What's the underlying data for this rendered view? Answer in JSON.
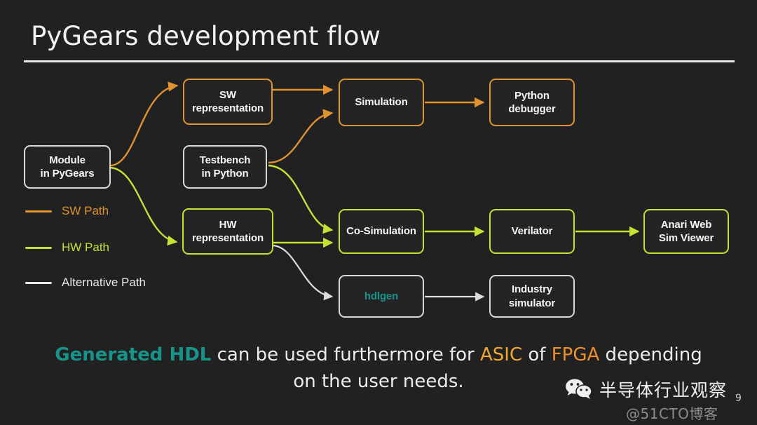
{
  "slide": {
    "title": "PyGears development flow",
    "page_number": "9",
    "background_color": "#212121"
  },
  "colors": {
    "sw_path": "#e0922f",
    "hw_path": "#c8e033",
    "alt_path": "#d8d8d8",
    "teal": "#17948a",
    "gold": "#f0a62f",
    "orange": "#ef8f2b",
    "text": "#f5f5f5"
  },
  "nodes": [
    {
      "id": "module",
      "label": "Module\nin PyGears",
      "style": "alt"
    },
    {
      "id": "sw-rep",
      "label": "SW\nrepresentation",
      "style": "sw"
    },
    {
      "id": "testbench",
      "label": "Testbench\nin Python",
      "style": "alt"
    },
    {
      "id": "hw-rep",
      "label": "HW\nrepresentation",
      "style": "hw"
    },
    {
      "id": "simulation",
      "label": "Simulation",
      "style": "sw"
    },
    {
      "id": "python-debugger",
      "label": "Python\ndebugger",
      "style": "sw"
    },
    {
      "id": "co-simulation",
      "label": "Co-Simulation",
      "style": "hw"
    },
    {
      "id": "verilator",
      "label": "Verilator",
      "style": "hw"
    },
    {
      "id": "anari",
      "label": "Anari Web\nSim Viewer",
      "style": "hw"
    },
    {
      "id": "hdlgen",
      "label": "hdlgen",
      "style": "alt"
    },
    {
      "id": "industry-simulator",
      "label": "Industry\nsimulator",
      "style": "alt"
    }
  ],
  "legend": [
    {
      "label": "SW Path",
      "color": "#e0922f"
    },
    {
      "label": "HW Path",
      "color": "#c8e033"
    },
    {
      "label": "Alternative Path",
      "color": "#e8e8e8"
    }
  ],
  "caption": {
    "part1": "Generated HDL",
    "part2": " can be used furthermore for ",
    "part3": "ASIC",
    "part4": " of ",
    "part5": "FPGA",
    "part6": " depending on the user needs."
  },
  "watermark": {
    "brand": "半导体行业观察",
    "source": "@51CTO博客",
    "icon": "wechat-icon"
  }
}
